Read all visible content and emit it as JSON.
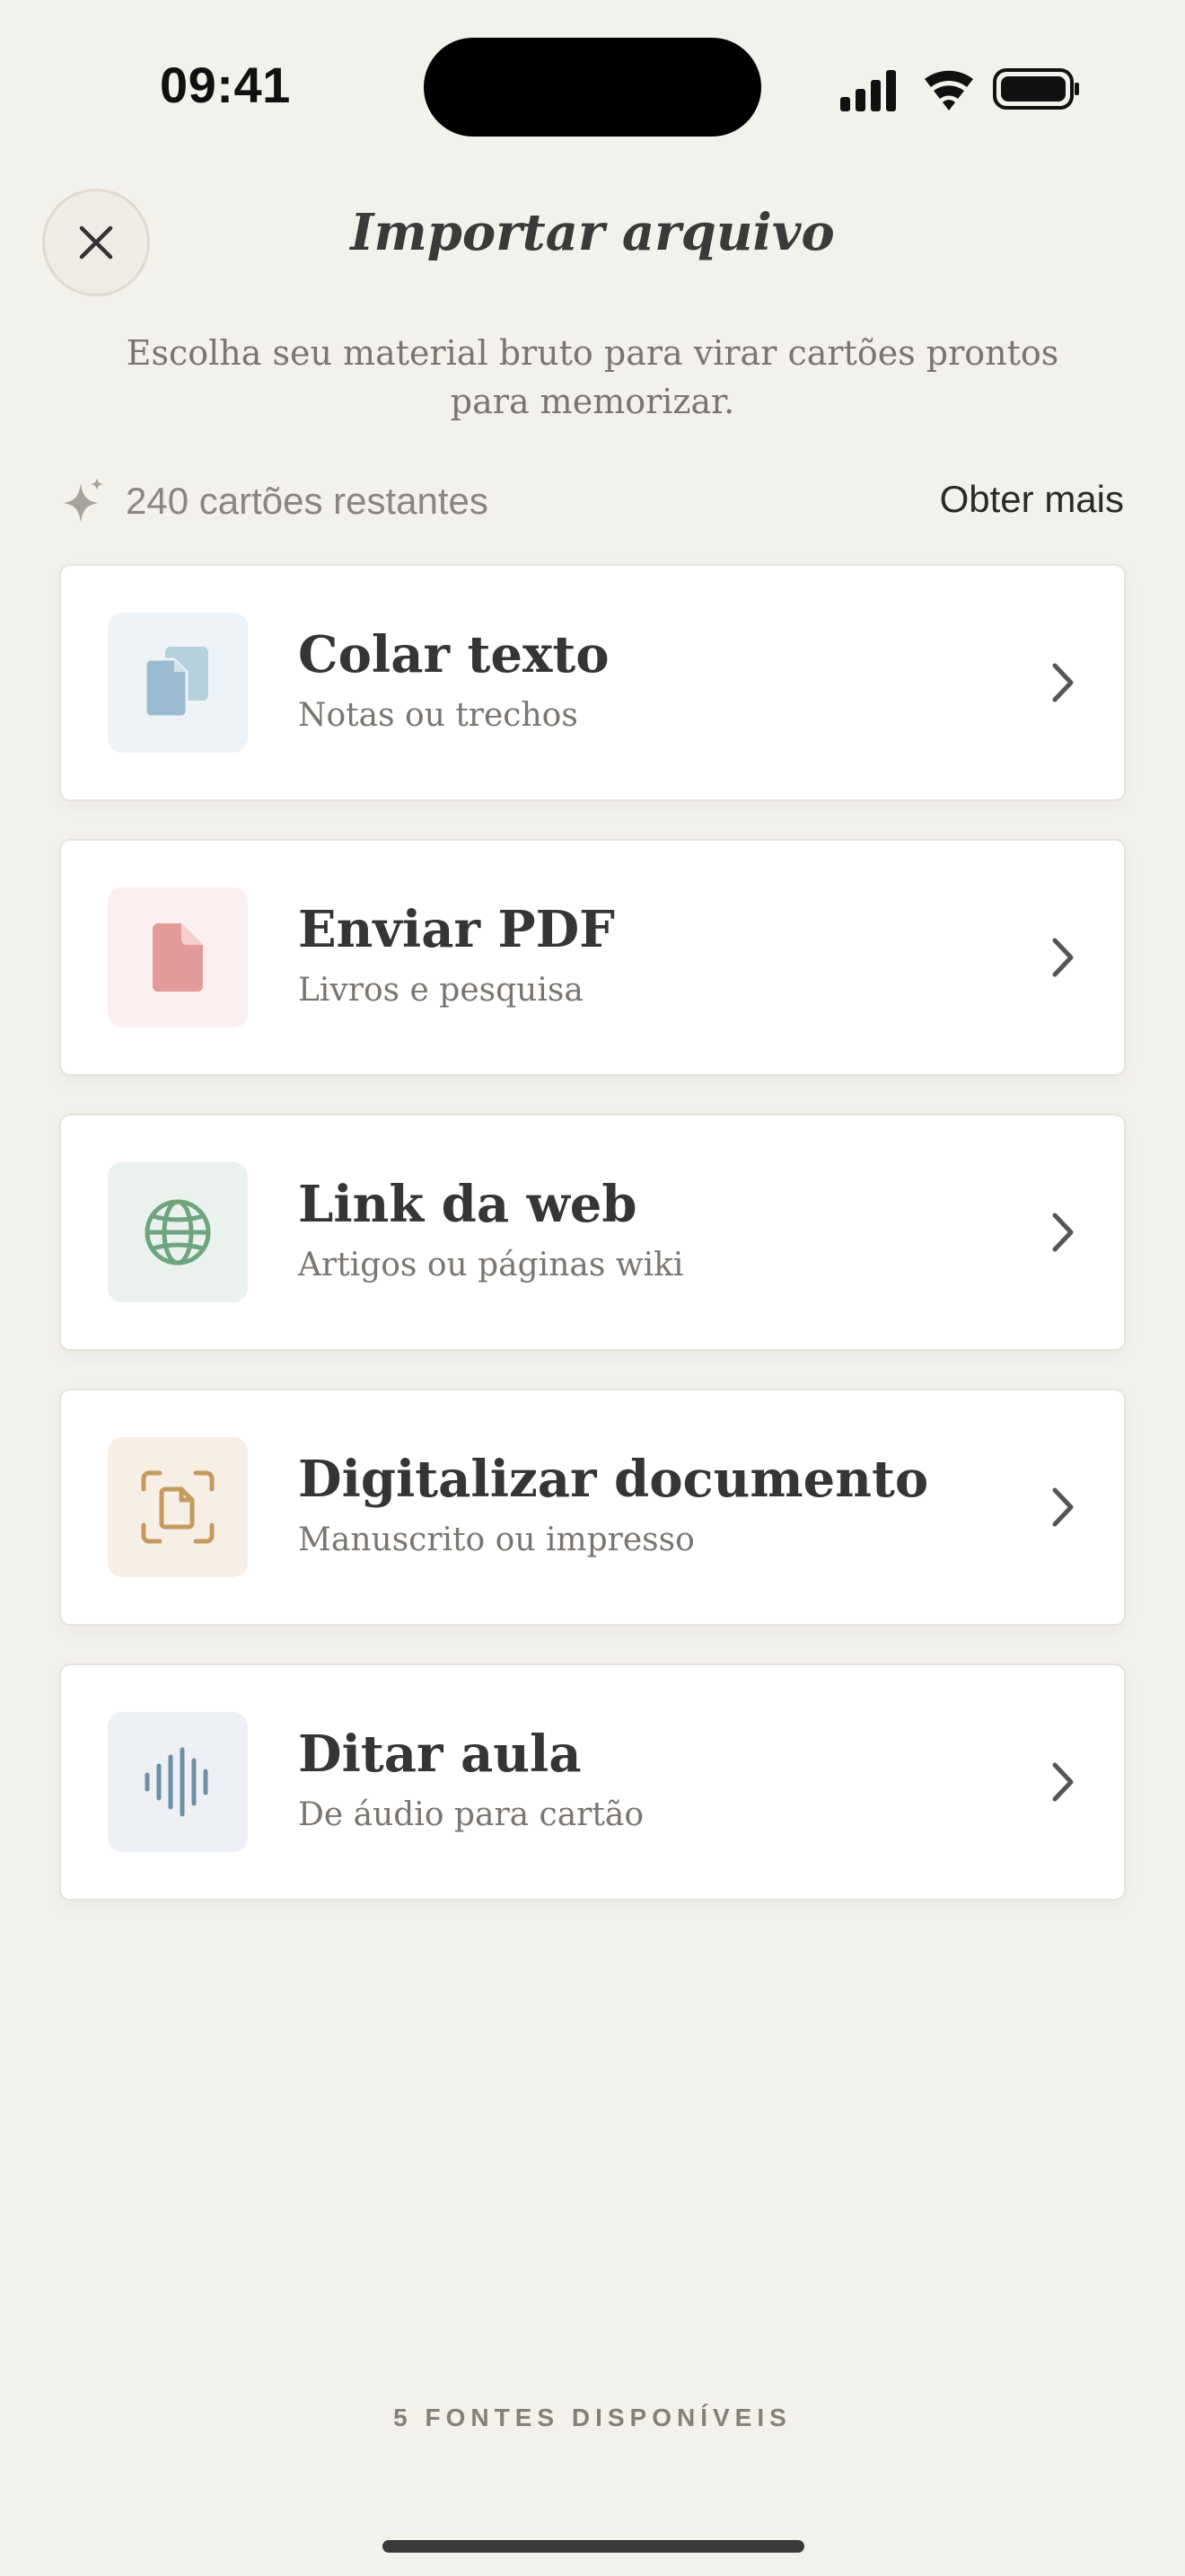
{
  "status_bar": {
    "time": "09:41"
  },
  "header": {
    "title": "Importar arquivo",
    "subtitle": "Escolha seu material bruto para virar cartões prontos para memorizar."
  },
  "credits": {
    "remaining": "240 cartões restantes",
    "get_more": "Obter mais"
  },
  "sources": [
    {
      "title": "Colar texto",
      "subtitle": "Notas ou trechos",
      "icon": "paste-icon",
      "tile_color": "#eef3f8",
      "icon_color": "#9bbcd0"
    },
    {
      "title": "Enviar PDF",
      "subtitle": "Livros e pesquisa",
      "icon": "pdf-file-icon",
      "tile_color": "#fbefef",
      "icon_color": "#e39a9a"
    },
    {
      "title": "Link da web",
      "subtitle": "Artigos ou páginas wiki",
      "icon": "globe-icon",
      "tile_color": "#ebf1ec",
      "icon_color": "#6fa57e"
    },
    {
      "title": "Digitalizar documento",
      "subtitle": "Manuscrito ou impresso",
      "icon": "scan-document-icon",
      "tile_color": "#f7efe6",
      "icon_color": "#c49a5e"
    },
    {
      "title": "Ditar aula",
      "subtitle": "De áudio para cartão",
      "icon": "waveform-icon",
      "tile_color": "#edf1f5",
      "icon_color": "#6e8fa8"
    }
  ],
  "footer": {
    "label": "5 FONTES DISPONÍVEIS"
  }
}
